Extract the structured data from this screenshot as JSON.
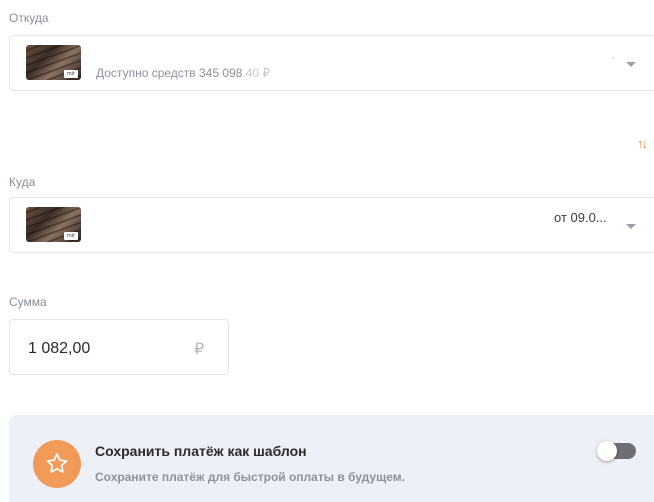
{
  "from": {
    "label": "Откуда",
    "available_prefix": "Доступно средств 345 098",
    "available_cents": ".40 ₽",
    "card_badge": "mir"
  },
  "swap_icon": "swap-arrows-icon",
  "to": {
    "label": "Куда",
    "date_text": "от 09.0...",
    "card_badge": "mir"
  },
  "amount": {
    "label": "Сумма",
    "value": "1 082,00",
    "currency": "₽"
  },
  "template": {
    "title": "Сохранить платёж как шаблон",
    "subtitle": "Сохраните платёж для быстрой оплаты в будущем.",
    "icon": "star-icon",
    "toggle_on": false
  },
  "colors": {
    "accent": "#f29a57",
    "swap": "#ef8a3c",
    "panel_bg": "#eef0f8",
    "toggle_off": "#6d6f74"
  }
}
